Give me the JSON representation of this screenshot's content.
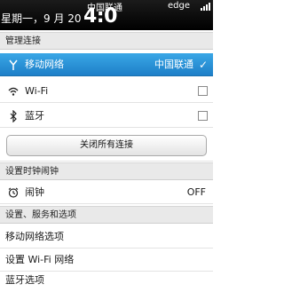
{
  "status_bar": {
    "date": "星期一，9 月 20",
    "carrier": "中国联通",
    "time": "4:0",
    "network": "edge"
  },
  "manage_connections": {
    "header": "管理连接",
    "mobile_network": {
      "label": "移动网络",
      "value": "中国联通",
      "checked": true
    },
    "wifi": {
      "label": "Wi-Fi",
      "checked": false
    },
    "bluetooth": {
      "label": "蓝牙",
      "checked": false
    },
    "close_all_button": "关闭所有连接"
  },
  "alarm_section": {
    "header": "设置时钟闹钟",
    "alarm": {
      "label": "闹钟",
      "value": "OFF"
    }
  },
  "settings_section": {
    "header": "设置、服务和选项",
    "items": [
      "移动网络选项",
      "设置 Wi-Fi 网络",
      "蓝牙选项"
    ]
  },
  "icons": {
    "mobile_network": "antenna-icon",
    "wifi": "wifi-icon",
    "bluetooth": "bluetooth-icon",
    "alarm": "alarm-clock-icon",
    "check": "checkmark-icon"
  },
  "colors": {
    "accent": "#1d7fc8",
    "statusbar": "#000000"
  }
}
